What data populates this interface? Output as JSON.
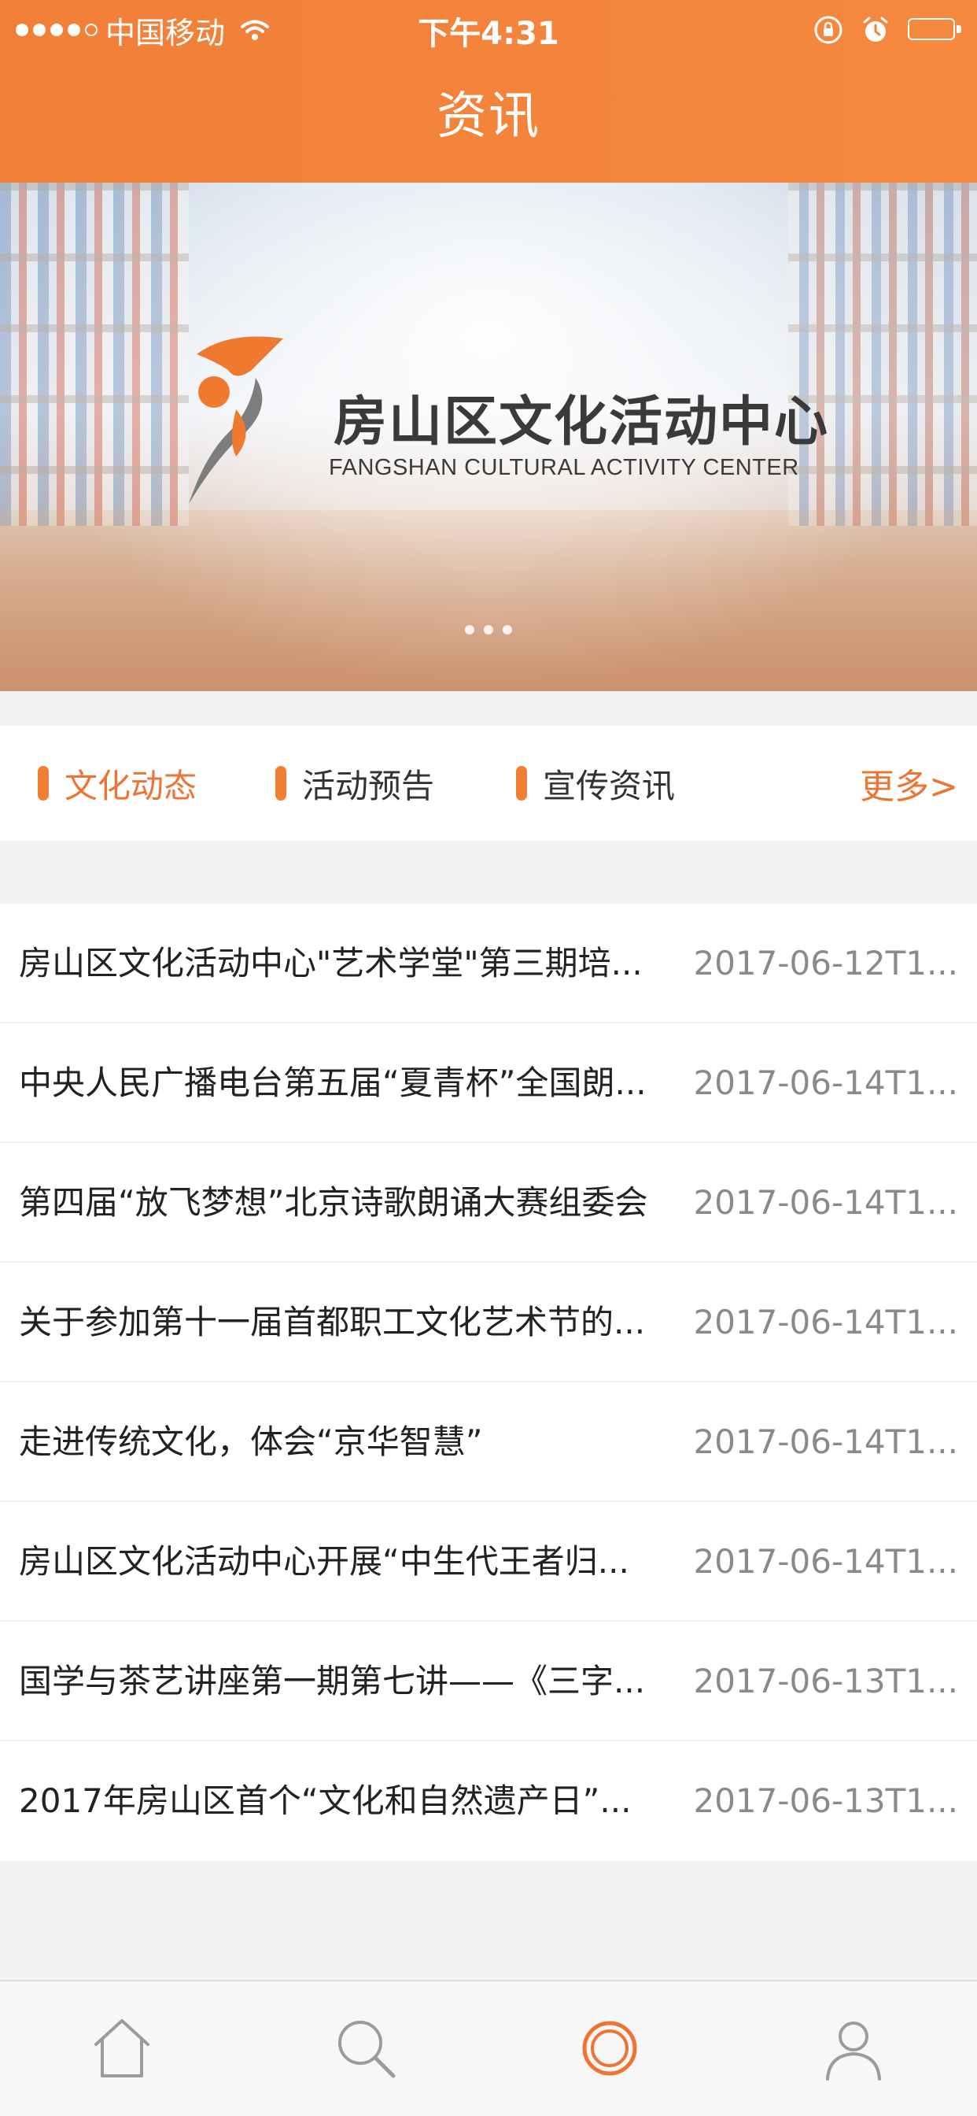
{
  "status_bar": {
    "carrier": "中国移动",
    "time": "下午4:31",
    "signal_icon": "signal-dots-icon",
    "wifi_icon": "wifi-icon",
    "lock_icon": "orientation-lock-icon",
    "alarm_icon": "alarm-icon",
    "battery_icon": "battery-icon",
    "battery_level": 1.0
  },
  "nav": {
    "title": "资讯"
  },
  "banner": {
    "logo_title": "房山区文化活动中心",
    "logo_subtitle": "FANGSHAN CULTURAL ACTIVITY CENTER",
    "page_count": 3,
    "current_page": 1
  },
  "tabs": {
    "items": [
      {
        "label": "文化动态",
        "active": true
      },
      {
        "label": "活动预告",
        "active": false
      },
      {
        "label": "宣传资讯",
        "active": false
      }
    ],
    "more_label": "更多>"
  },
  "news": [
    {
      "title": "房山区文化活动中心\"艺术学堂\"第三期培...",
      "date": "2017-06-12T1..."
    },
    {
      "title": "中央人民广播电台第五届“夏青杯”全国朗...",
      "date": "2017-06-14T1..."
    },
    {
      "title": "第四届“放飞梦想”北京诗歌朗诵大赛组委会",
      "date": "2017-06-14T1..."
    },
    {
      "title": "关于参加第十一届首都职工文化艺术节的...",
      "date": "2017-06-14T1..."
    },
    {
      "title": "走进传统文化，体会“京华智慧”",
      "date": "2017-06-14T1..."
    },
    {
      "title": "房山区文化活动中心开展“中生代王者归...",
      "date": "2017-06-14T1..."
    },
    {
      "title": "国学与茶艺讲座第一期第七讲——《三字...",
      "date": "2017-06-13T1..."
    },
    {
      "title": "2017年房山区首个“文化和自然遗产日”...",
      "date": "2017-06-13T1..."
    }
  ],
  "tabbar": {
    "items": [
      {
        "icon": "home-icon",
        "active": false
      },
      {
        "icon": "search-icon",
        "active": false
      },
      {
        "icon": "news-ring-icon",
        "active": true
      },
      {
        "icon": "user-icon",
        "active": false
      }
    ]
  },
  "colors": {
    "accent": "#ef7433",
    "header": "#f38339",
    "inactive_icon": "#9b9b9b"
  }
}
